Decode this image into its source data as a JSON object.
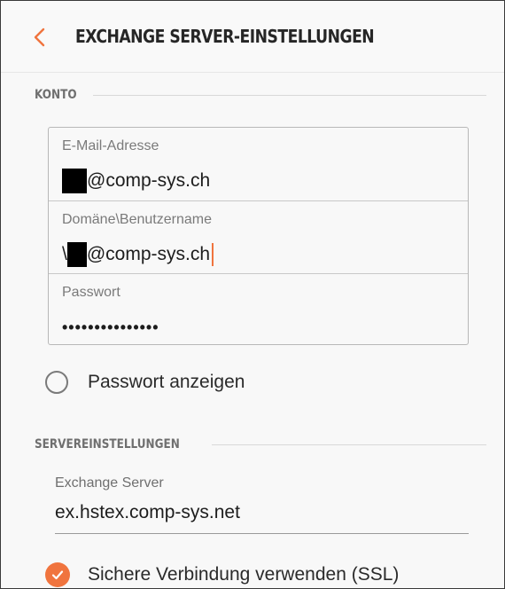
{
  "header": {
    "title": "EXCHANGE SERVER-EINSTELLUNGEN",
    "back_icon": "chevron-left-icon"
  },
  "accent_color": "#f0743e",
  "account_section": {
    "label": "KONTO",
    "email": {
      "label": "E-Mail-Adresse",
      "value_suffix": "@comp-sys.ch"
    },
    "username": {
      "label": "Domäne\\Benutzername",
      "value_prefix": "\\",
      "value_suffix": "@comp-sys.ch"
    },
    "password": {
      "label": "Passwort",
      "value": "•••••••••••••••"
    }
  },
  "show_password": {
    "label": "Passwort anzeigen",
    "checked": false
  },
  "server_section": {
    "label": "SERVEREINSTELLUNGEN",
    "exchange_server": {
      "label": "Exchange Server",
      "value": "ex.hstex.comp-sys.net"
    }
  },
  "ssl": {
    "label": "Sichere Verbindung verwenden (SSL)",
    "checked": true
  }
}
